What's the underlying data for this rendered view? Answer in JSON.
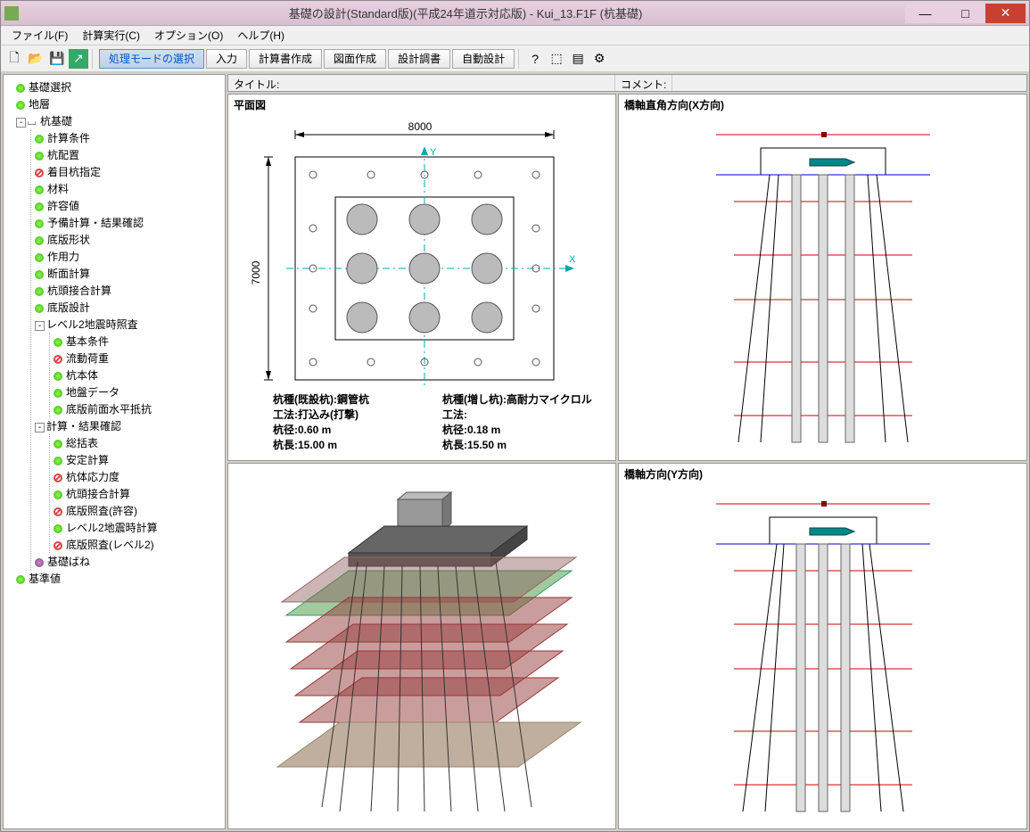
{
  "window": {
    "title": "基礎の設計(Standard版)(平成24年道示対応版) - Kui_13.F1F (杭基礎)"
  },
  "menu": {
    "file": "ファイル(F)",
    "calc": "計算実行(C)",
    "option": "オプション(O)",
    "help": "ヘルプ(H)"
  },
  "toolbar": {
    "mode_select": "処理モードの選択",
    "input": "入力",
    "calc_doc": "計算書作成",
    "drawing": "図面作成",
    "design_spec": "設計調書",
    "auto_design": "自動設計"
  },
  "header": {
    "title_label": "タイトル:",
    "comment_label": "コメント:"
  },
  "tree": {
    "n0": "基礎選択",
    "n1": "地層",
    "n2": "杭基礎",
    "n2_0": "計算条件",
    "n2_1": "杭配置",
    "n2_2": "着目杭指定",
    "n2_3": "材料",
    "n2_4": "許容値",
    "n2_5": "予備計算・結果確認",
    "n2_6": "底版形状",
    "n2_7": "作用力",
    "n2_8": "断面計算",
    "n2_9": "杭頭接合計算",
    "n2_10": "底版設計",
    "n2_11": "レベル2地震時照査",
    "n2_11_0": "基本条件",
    "n2_11_1": "流動荷重",
    "n2_11_2": "杭本体",
    "n2_11_3": "地盤データ",
    "n2_11_4": "底版前面水平抵抗",
    "n2_12": "計算・結果確認",
    "n2_12_0": "総括表",
    "n2_12_1": "安定計算",
    "n2_12_2": "杭体応力度",
    "n2_12_3": "杭頭接合計算",
    "n2_12_4": "底版照査(許容)",
    "n2_12_5": "レベル2地震時計算",
    "n2_12_6": "底版照査(レベル2)",
    "n2_13": "基礎ばね",
    "n3": "基準値"
  },
  "plan": {
    "title": "平面図",
    "width": "8000",
    "height": "7000",
    "l1a": "杭種(既設杭):鋼管杭",
    "l2a": "工法:打込み(打撃)",
    "l3a": "杭径:0.60 m",
    "l4a": "杭長:15.00 m",
    "l1b": "杭種(増し杭):高耐力マイクロル",
    "l2b": "工法:",
    "l3b": "杭径:0.18 m",
    "l4b": "杭長:15.50 m"
  },
  "elev1": {
    "title": "橋軸直角方向(X方向)"
  },
  "elev2": {
    "title": "橋軸方向(Y方向)"
  }
}
